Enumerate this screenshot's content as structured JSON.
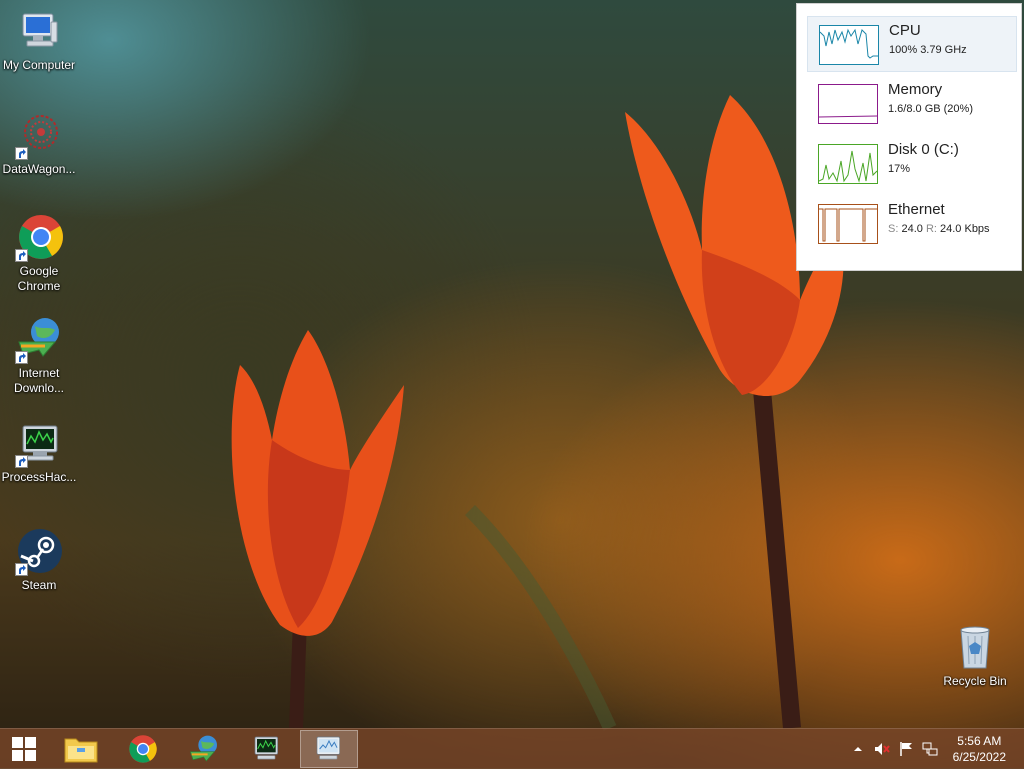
{
  "desktop": {
    "icons": [
      {
        "label": "My Computer"
      },
      {
        "label": "DataWagon..."
      },
      {
        "label": "Google Chrome"
      },
      {
        "label": "Internet Downlo..."
      },
      {
        "label": "ProcessHac..."
      },
      {
        "label": "Steam"
      },
      {
        "label": "Recycle Bin"
      }
    ]
  },
  "performance": {
    "items": [
      {
        "name": "CPU",
        "value": "100%  3.79 GHz",
        "color": "#1a86a8"
      },
      {
        "name": "Memory",
        "value": "1.6/8.0 GB (20%)",
        "color": "#8b1a8b"
      },
      {
        "name": "Disk 0 (C:)",
        "value": "17%",
        "color": "#4aa626"
      },
      {
        "name": "Ethernet",
        "sent_label": "S:",
        "sent": "24.0",
        "recv_label": "R:",
        "recv": "24.0 Kbps",
        "color": "#a7501a"
      }
    ]
  },
  "taskbar": {
    "apps": [
      "start",
      "file-explorer",
      "google-chrome",
      "internet-download-manager",
      "process-hacker",
      "task-manager"
    ],
    "clock": {
      "time": "5:56 AM",
      "date": "6/25/2022"
    }
  }
}
